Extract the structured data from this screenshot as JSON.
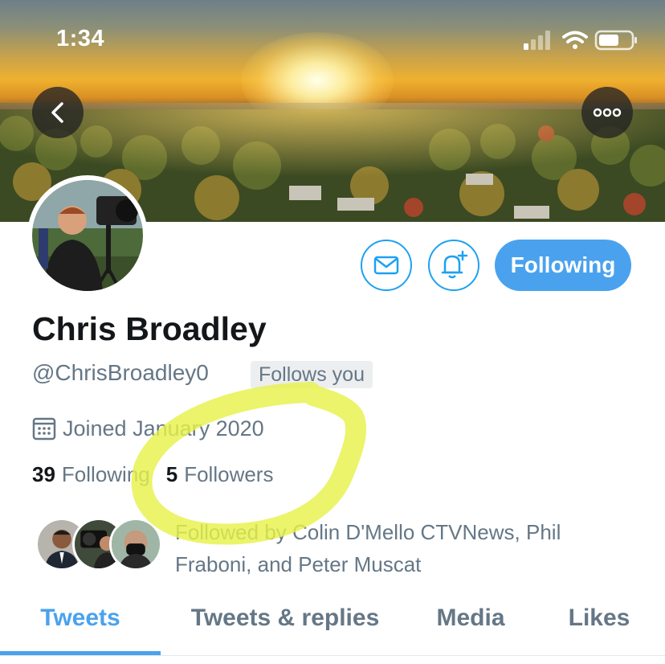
{
  "status_bar": {
    "time": "1:34",
    "signal_icon": "cellular-signal-icon",
    "wifi_icon": "wifi-icon",
    "battery_icon": "battery-icon"
  },
  "header": {
    "back_icon": "chevron-left-icon",
    "more_icon": "more-horizontal-icon"
  },
  "profile": {
    "name": "Chris Broadley",
    "handle": "@ChrisBroadley0",
    "follows_you": "Follows you",
    "joined": "Joined January 2020",
    "following_count": "39",
    "following_label": "Following",
    "followers_count": "5",
    "followers_label": "Followers",
    "followed_by_text": "Followed by Colin D'Mello CTVNews, Phil Fraboni, and Peter Muscat"
  },
  "actions": {
    "message_icon": "mail-icon",
    "notify_icon": "bell-plus-icon",
    "following_button": "Following"
  },
  "tabs": [
    {
      "label": "Tweets",
      "active": true
    },
    {
      "label": "Tweets & replies",
      "active": false
    },
    {
      "label": "Media",
      "active": false
    },
    {
      "label": "Likes",
      "active": false
    }
  ],
  "colors": {
    "accent": "#4aa2ee",
    "secondary_text": "#657786",
    "primary_text": "#14171a",
    "highlight_marker": "#e6f24a"
  }
}
